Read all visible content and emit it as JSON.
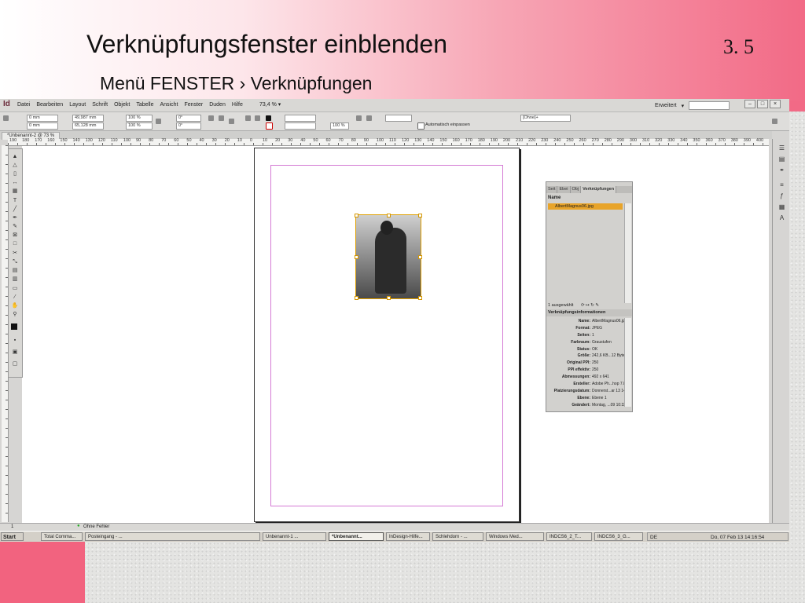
{
  "slide": {
    "title": "Verknüpfungsfenster einblenden",
    "number": "3. 5",
    "subtitle": "Menü FENSTER › Verknüpfungen"
  },
  "app": {
    "icon": "Id",
    "menu": [
      "Datei",
      "Bearbeiten",
      "Layout",
      "Schrift",
      "Objekt",
      "Tabelle",
      "Ansicht",
      "Fenster",
      "Duden",
      "Hilfe"
    ],
    "zoom": "73,4 %",
    "workspace": "Erweitert",
    "document_tab": "*Unbenannt-2 @ 73 %",
    "control": {
      "x": "0 mm",
      "y": "0 mm",
      "w": "49,987 mm",
      "h": "65,128 mm",
      "scale_x": "100 %",
      "scale_y": "100 %",
      "rot": "0°",
      "shear": "0°",
      "stroke_pct": "100 %",
      "autofit": "Automatisch einpassen",
      "style": "[Ohne]+"
    }
  },
  "ruler_labels": [
    "190",
    "180",
    "170",
    "160",
    "150",
    "140",
    "130",
    "120",
    "110",
    "100",
    "90",
    "80",
    "70",
    "60",
    "50",
    "40",
    "30",
    "20",
    "10",
    "0",
    "10",
    "20",
    "30",
    "40",
    "50",
    "60",
    "70",
    "80",
    "90",
    "100",
    "110",
    "120",
    "130",
    "140",
    "150",
    "160",
    "170",
    "180",
    "190",
    "200",
    "210",
    "220",
    "230",
    "240",
    "250",
    "260",
    "270",
    "280",
    "290",
    "300",
    "310",
    "320",
    "330",
    "340",
    "350",
    "360",
    "370",
    "380",
    "390",
    "400"
  ],
  "links_panel": {
    "tabs": [
      "Seit",
      "Ebei",
      "Obj",
      "Verknüpfungen"
    ],
    "name_header": "Name",
    "file": "AlbertMagnus06.jpg",
    "footer": "1 ausgewählt",
    "info_header": "Verknüpfungsinformationen",
    "info": [
      {
        "k": "Name:",
        "v": "AlbertMagnus06.jpg"
      },
      {
        "k": "Format:",
        "v": "JPEG"
      },
      {
        "k": "Seiten:",
        "v": "1"
      },
      {
        "k": "Farbraum:",
        "v": "Graustufen"
      },
      {
        "k": "Status:",
        "v": "OK"
      },
      {
        "k": "Größe:",
        "v": "242,6 KB...12 Byte)"
      },
      {
        "k": "Original PPI:",
        "v": "250"
      },
      {
        "k": "PPI effektiv:",
        "v": "250"
      },
      {
        "k": "Abmessungen:",
        "v": "492 x 641"
      },
      {
        "k": "Ersteller:",
        "v": "Adobe Ph...hop 7.0"
      },
      {
        "k": "Platzierungsdatum:",
        "v": "Donnerst...ar 13 14:16"
      },
      {
        "k": "Ebene:",
        "v": "Ebene 1"
      },
      {
        "k": "Geändert:",
        "v": "Montag, ...09 10:32"
      }
    ]
  },
  "status": {
    "page": "1",
    "preflight": "Ohne Fehler"
  },
  "taskbar": {
    "start": "Start",
    "tasks": [
      {
        "label": "Total Comma...",
        "active": false
      },
      {
        "label": "Posteingang - ...",
        "active": false
      },
      {
        "label": "Unbenannt-1 ...",
        "active": false
      },
      {
        "label": "*Unbenannt...",
        "active": true
      },
      {
        "label": "InDesign-Hilfe...",
        "active": false
      },
      {
        "label": "Schlehdorn - ...",
        "active": false
      },
      {
        "label": "Windows Med...",
        "active": false
      },
      {
        "label": "INDCS6_2_T...",
        "active": false
      },
      {
        "label": "INDCS6_3_G...",
        "active": false
      }
    ],
    "lang": "DE",
    "clock": "Do, 07 Feb 13  14:16:54"
  }
}
